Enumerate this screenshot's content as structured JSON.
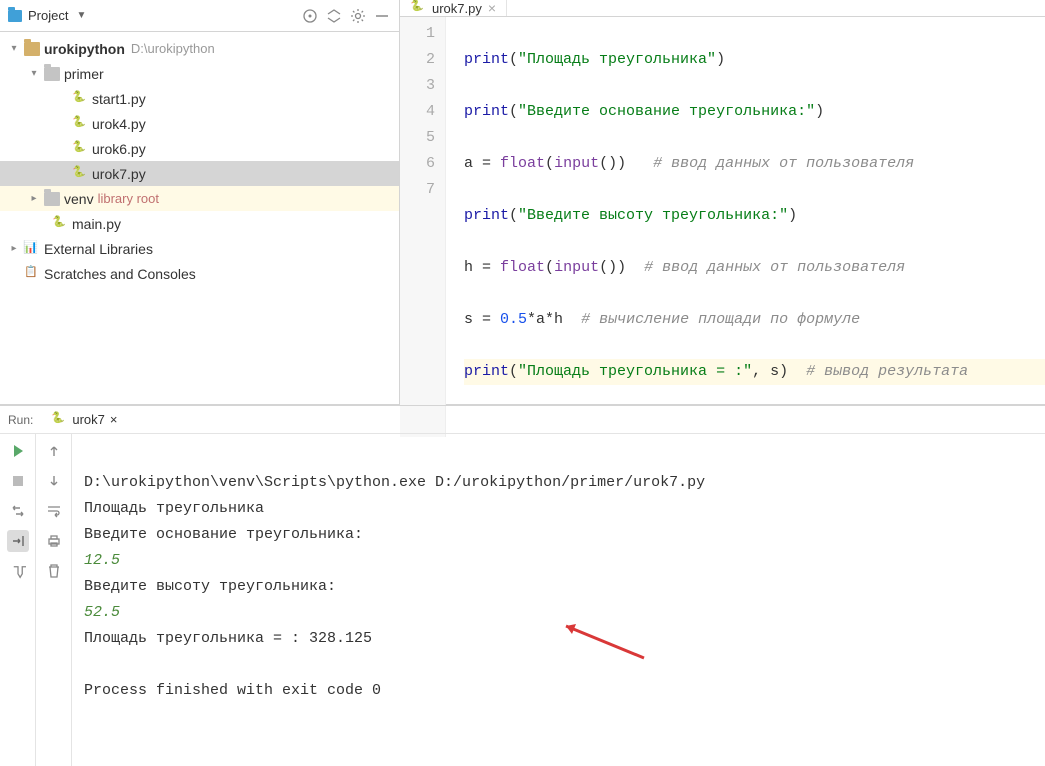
{
  "sidebar": {
    "title": "Project",
    "root": {
      "name": "urokipython",
      "path": "D:\\urokipython"
    },
    "folders": {
      "primer": "primer",
      "venv": "venv",
      "venv_note": "library root"
    },
    "files": {
      "start1": "start1.py",
      "urok4": "urok4.py",
      "urok6": "urok6.py",
      "urok7": "urok7.py",
      "main": "main.py"
    },
    "external": "External Libraries",
    "scratches": "Scratches and Consoles"
  },
  "editor": {
    "tab_name": "urok7.py",
    "gutter": [
      "1",
      "2",
      "3",
      "4",
      "5",
      "6",
      "7"
    ],
    "code": {
      "l1_str": "\"Площадь треугольника\"",
      "l2_str": "\"Введите основание треугольника:\"",
      "l3_var": "a",
      "l3_cmt": "# ввод данных от пользователя",
      "l4_str": "\"Введите высоту треугольника:\"",
      "l5_var": "h",
      "l5_cmt": "# ввод данных от пользователя",
      "l6_var": "s",
      "l6_num": "0.5",
      "l6_expr": "*a*h",
      "l6_cmt": "# вычисление площади по формуле",
      "l7_str": "\"Площадь треугольника = :\"",
      "l7_arg": ", s",
      "l7_cmt": "# вывод результата",
      "print": "print",
      "float": "float",
      "input": "input",
      "eq": " = "
    }
  },
  "run": {
    "label": "Run:",
    "tab": "urok7",
    "cmd": "D:\\urokipython\\venv\\Scripts\\python.exe D:/urokipython/primer/urok7.py",
    "out1": "Площадь треугольника",
    "out2": "Введите основание треугольника:",
    "in1": "12.5",
    "out3": "Введите высоту треугольника:",
    "in2": "52.5",
    "out4": "Площадь треугольника = : 328.125",
    "exit": "Process finished with exit code 0"
  }
}
